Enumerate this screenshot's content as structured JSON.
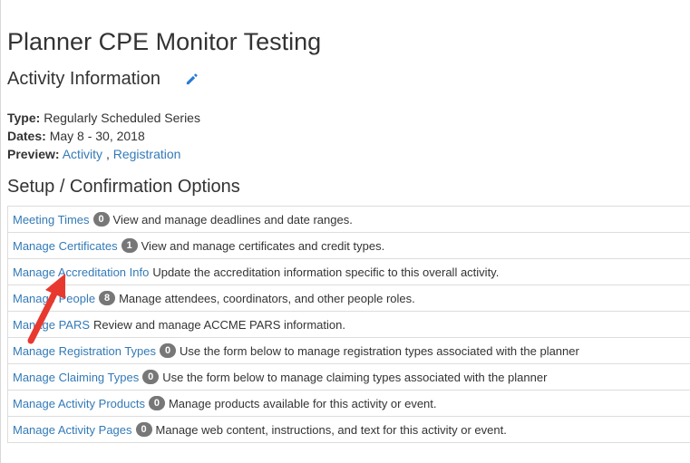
{
  "page": {
    "title": "Planner CPE Monitor Testing"
  },
  "activity": {
    "heading": "Activity Information",
    "type_label": "Type:",
    "type_value": "Regularly Scheduled Series",
    "dates_label": "Dates:",
    "dates_value": "May 8 - 30, 2018",
    "preview_label": "Preview:",
    "preview_links": [
      "Activity",
      "Registration"
    ],
    "preview_separator": " ,"
  },
  "setup": {
    "heading": "Setup / Confirmation Options",
    "options": [
      {
        "link": "Meeting Times",
        "badge": "0",
        "description": "View and manage deadlines and date ranges."
      },
      {
        "link": "Manage Certificates",
        "badge": "1",
        "description": "View and manage certificates and credit types."
      },
      {
        "link": "Manage Accreditation Info",
        "badge": "",
        "description": "Update the accreditation information specific to this overall activity."
      },
      {
        "link": "Manage People",
        "badge": "8",
        "description": "Manage attendees, coordinators, and other people roles."
      },
      {
        "link": "Manage PARS",
        "badge": "",
        "description": "Review and manage ACCME PARS information."
      },
      {
        "link": "Manage Registration Types",
        "badge": "0",
        "description": "Use the form below to manage registration types associated with the planner"
      },
      {
        "link": "Manage Claiming Types",
        "badge": "0",
        "description": "Use the form below to manage claiming types associated with the planner"
      },
      {
        "link": "Manage Activity Products",
        "badge": "0",
        "description": "Manage products available for this activity or event."
      },
      {
        "link": "Manage Activity Pages",
        "badge": "0",
        "description": "Manage web content, instructions, and text for this activity or event."
      }
    ]
  },
  "icons": {
    "edit": "pencil-icon",
    "annotation": "red-arrow-icon"
  },
  "colors": {
    "link": "#337ab7",
    "badge": "#777777",
    "arrow": "#e8392f",
    "edit_icon": "#2a7ad3"
  }
}
